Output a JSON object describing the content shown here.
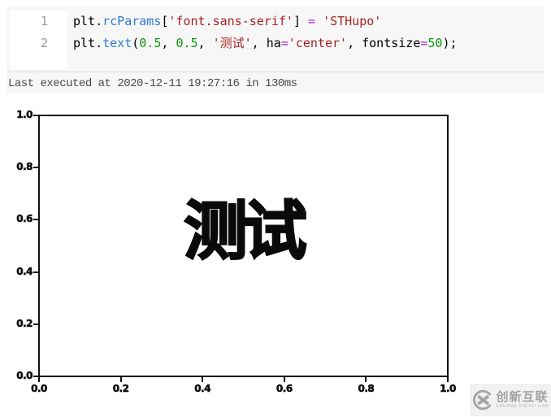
{
  "notebook": {
    "cell": {
      "lines": [
        {
          "number": "1",
          "tokens": [
            {
              "text": "plt.",
              "color": "code_default"
            },
            {
              "text": "rcParams",
              "color": "code_property"
            },
            {
              "text": "[",
              "color": "code_default"
            },
            {
              "text": "'font.sans-serif'",
              "color": "code_string"
            },
            {
              "text": "] ",
              "color": "code_default"
            },
            {
              "text": "=",
              "color": "code_operator"
            },
            {
              "text": " ",
              "color": "code_default"
            },
            {
              "text": "'STHupo'",
              "color": "code_string"
            }
          ]
        },
        {
          "number": "2",
          "tokens": [
            {
              "text": "plt.",
              "color": "code_default"
            },
            {
              "text": "text",
              "color": "code_property"
            },
            {
              "text": "(",
              "color": "code_default"
            },
            {
              "text": "0.5",
              "color": "code_number"
            },
            {
              "text": ", ",
              "color": "code_default"
            },
            {
              "text": "0.5",
              "color": "code_number"
            },
            {
              "text": ", ",
              "color": "code_default"
            },
            {
              "text": "'测试'",
              "color": "code_string"
            },
            {
              "text": ", ha",
              "color": "code_default"
            },
            {
              "text": "=",
              "color": "code_operator"
            },
            {
              "text": "'center'",
              "color": "code_string"
            },
            {
              "text": ", fontsize",
              "color": "code_default"
            },
            {
              "text": "=",
              "color": "code_operator"
            },
            {
              "text": "50",
              "color": "code_number"
            },
            {
              "text": ");",
              "color": "code_default"
            }
          ]
        }
      ]
    },
    "status_text": "Last executed at 2020-12-11 19:27:16 in 130ms"
  },
  "figure": {
    "center_text": "测试",
    "x_tick_labels": [
      "0.0",
      "0.2",
      "0.4",
      "0.6",
      "0.8",
      "1.0"
    ],
    "y_tick_labels": [
      "1.0",
      "0.8",
      "0.6",
      "0.4",
      "0.2",
      "0.0"
    ]
  },
  "watermark": {
    "cn": "创新互联",
    "en": "CHUANG XIN HU LIAN"
  },
  "colors": {
    "cell_background": "#f7f7f7",
    "gutter_background": "#ffffff",
    "line_number": "#999999",
    "code_default": "#000000",
    "code_property": "#2e7bd2",
    "code_string": "#a82121",
    "code_number": "#0b960b",
    "code_operator": "#ab27ce",
    "status_text": "#4a4a4a",
    "axis": "#111111",
    "plot_text": "#0a0a0a",
    "watermark_gray": "#a3a3a3"
  },
  "chart_data": {
    "type": "scatter",
    "points": [],
    "title": "",
    "xlabel": "",
    "ylabel": "",
    "xlim": [
      0.0,
      1.0
    ],
    "ylim": [
      0.0,
      1.0
    ],
    "xticks": [
      0.0,
      0.2,
      0.4,
      0.6,
      0.8,
      1.0
    ],
    "yticks": [
      0.0,
      0.2,
      0.4,
      0.6,
      0.8,
      1.0
    ],
    "grid": false,
    "legend": false,
    "annotations": [
      {
        "x": 0.5,
        "y": 0.5,
        "text": "测试",
        "ha": "center",
        "fontsize": 50,
        "font": "STHupo",
        "color": "#000000"
      }
    ]
  }
}
